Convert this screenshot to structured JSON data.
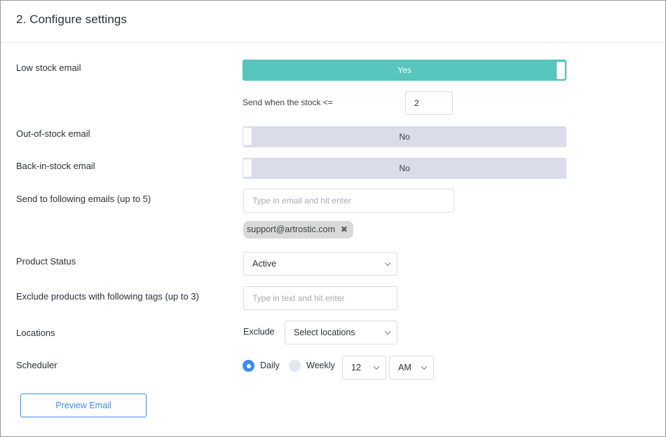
{
  "header": {
    "title": "2. Configure settings"
  },
  "rows": {
    "low_stock": {
      "label": "Low stock email",
      "toggle_text": "Yes",
      "threshold_label": "Send when the stock <=",
      "threshold_value": "2"
    },
    "out_of_stock": {
      "label": "Out-of-stock email",
      "toggle_text": "No"
    },
    "back_in_stock": {
      "label": "Back-in-stock email",
      "toggle_text": "No"
    },
    "emails": {
      "label": "Send to following emails (up to 5)",
      "placeholder": "Type in email and hit enter",
      "chips": [
        "support@artrostic.com"
      ],
      "chip_remove": "✖"
    },
    "product_status": {
      "label": "Product Status",
      "selected": "Active"
    },
    "exclude_tags": {
      "label": "Exclude products with following tags (up to 3)",
      "placeholder": "Type in text and hit enter"
    },
    "locations": {
      "label": "Locations",
      "mode_label": "Exclude",
      "select_placeholder": "Select locations"
    },
    "scheduler": {
      "label": "Scheduler",
      "options": [
        "Daily",
        "Weekly"
      ],
      "selected_option": "Daily",
      "hour": "12",
      "ampm": "AM"
    }
  },
  "actions": {
    "preview_label": "Preview Email"
  },
  "colors": {
    "toggle_on": "#57c7bd",
    "toggle_off": "#dadde9",
    "accent_blue": "#3b8bf6"
  }
}
